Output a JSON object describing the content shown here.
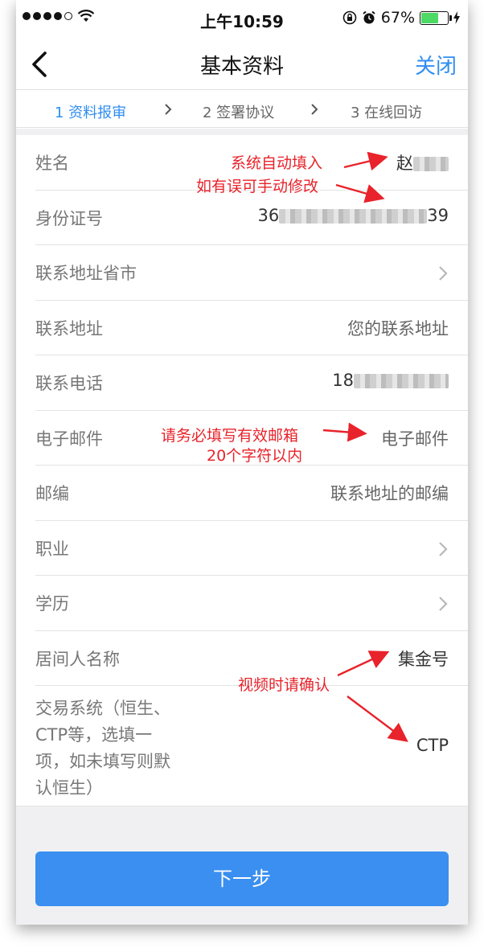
{
  "status": {
    "time": "上午10:59",
    "battery": "67%",
    "battery_level": 0.67
  },
  "nav": {
    "title": "基本资料",
    "close_label": "关闭"
  },
  "steps": [
    {
      "label": "1 资料报审",
      "active": true
    },
    {
      "label": "2 签署协议",
      "active": false
    },
    {
      "label": "3 在线回访",
      "active": false
    }
  ],
  "form": {
    "name": {
      "label": "姓名",
      "value_prefix": "赵"
    },
    "id_number": {
      "label": "身份证号",
      "value_prefix": "36",
      "value_suffix": "39"
    },
    "province_city": {
      "label": "联系地址省市"
    },
    "address": {
      "label": "联系地址",
      "placeholder": "您的联系地址"
    },
    "phone": {
      "label": "联系电话",
      "value_prefix": "18"
    },
    "email": {
      "label": "电子邮件",
      "placeholder": "电子邮件"
    },
    "postcode": {
      "label": "邮编",
      "placeholder": "联系地址的邮编"
    },
    "occupation": {
      "label": "职业"
    },
    "education": {
      "label": "学历"
    },
    "broker": {
      "label": "居间人名称",
      "value": "集金号"
    },
    "trade_system": {
      "label": "交易系统（恒生、CTP等，选填一项，如未填写则默认恒生）",
      "value": "CTP"
    }
  },
  "next_button": "下一步",
  "annotations": {
    "auto_fill_1": "系统自动填入",
    "auto_fill_2": "如有误可手动修改",
    "email_1": "请务必填写有效邮箱",
    "email_2": "20个字符以内",
    "video": "视频时请确认"
  },
  "colors": {
    "accent": "#2f8df0",
    "button": "#3a8ff0",
    "annotation": "#e8232b",
    "battery": "#4cd964"
  }
}
